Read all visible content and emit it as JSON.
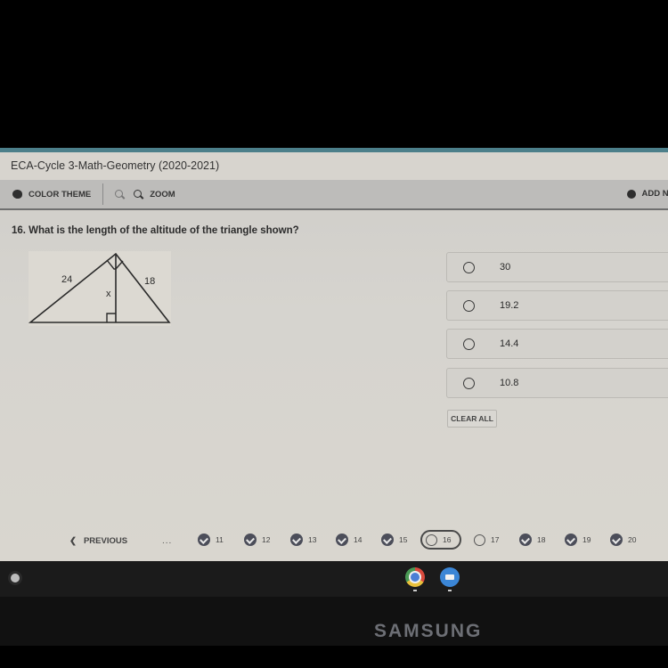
{
  "window": {
    "title": "ECA-Cycle 3-Math-Geometry (2020-2021)"
  },
  "toolbar": {
    "color_theme_label": "COLOR THEME",
    "zoom_label": "ZOOM",
    "add_note_label": "ADD NO",
    "icons": [
      "palette-icon",
      "zoom-out-icon",
      "zoom-in-icon",
      "add-note-icon"
    ]
  },
  "question": {
    "text": "16. What is the length of the altitude of the triangle shown?",
    "diagram": {
      "left_leg_label": "24",
      "right_leg_label": "18",
      "altitude_label": "x"
    }
  },
  "choices": [
    {
      "label": "30",
      "selected": false
    },
    {
      "label": "19.2",
      "selected": false
    },
    {
      "label": "14.4",
      "selected": false
    },
    {
      "label": "10.8",
      "selected": false
    }
  ],
  "clear_all_label": "CLEAR ALL",
  "navigation": {
    "previous_label": "PREVIOUS",
    "ellipsis": "...",
    "questions": [
      {
        "number": "11",
        "status": "answered"
      },
      {
        "number": "12",
        "status": "answered"
      },
      {
        "number": "13",
        "status": "answered"
      },
      {
        "number": "14",
        "status": "answered"
      },
      {
        "number": "15",
        "status": "answered"
      },
      {
        "number": "16",
        "status": "current"
      },
      {
        "number": "17",
        "status": "unanswered"
      },
      {
        "number": "18",
        "status": "answered"
      },
      {
        "number": "19",
        "status": "answered"
      },
      {
        "number": "20",
        "status": "answered"
      }
    ]
  },
  "shelf": {
    "apps": [
      "chrome-icon",
      "zoom-app-icon"
    ]
  },
  "device": {
    "brand": "SAMSUNG"
  }
}
